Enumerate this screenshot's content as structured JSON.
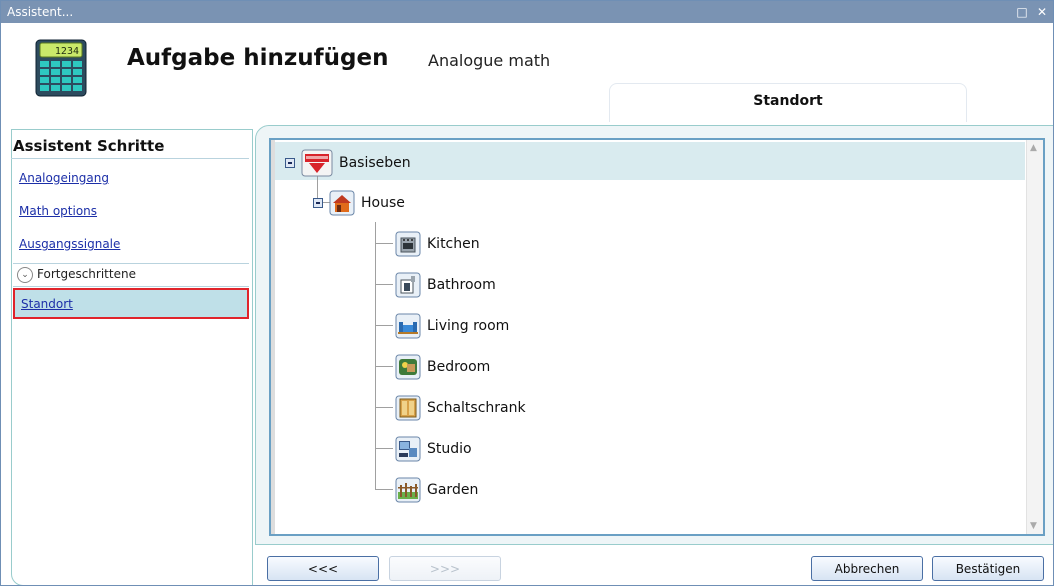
{
  "window": {
    "title": "Assistent...",
    "restore_glyph": "□",
    "close_glyph": "✕"
  },
  "header": {
    "title": "Aufgabe hinzufügen",
    "subtitle": "Analogue math",
    "icon": "calculator-icon",
    "calc_display": "1234"
  },
  "tab": {
    "label": "Standort"
  },
  "steps": {
    "title": "Assistent Schritte",
    "items": [
      {
        "label": "Analogeingang"
      },
      {
        "label": "Math options"
      },
      {
        "label": "Ausgangssignale"
      }
    ],
    "advanced_label": "Fortgeschrittene",
    "selected_label": "Standort"
  },
  "tree": {
    "root": {
      "label": "Basiseben",
      "icon": "carlo-gavazzi-logo-icon"
    },
    "house": {
      "label": "House",
      "icon": "house-icon"
    },
    "rooms": [
      {
        "label": "Kitchen",
        "icon": "kitchen-icon"
      },
      {
        "label": "Bathroom",
        "icon": "bathroom-icon"
      },
      {
        "label": "Living room",
        "icon": "sofa-icon"
      },
      {
        "label": "Bedroom",
        "icon": "bedroom-icon"
      },
      {
        "label": "Schaltschrank",
        "icon": "cabinet-icon"
      },
      {
        "label": "Studio",
        "icon": "studio-icon"
      },
      {
        "label": "Garden",
        "icon": "garden-icon"
      }
    ]
  },
  "buttons": {
    "back": "<<<",
    "next": ">>>",
    "cancel": "Abbrechen",
    "confirm": "Bestätigen"
  },
  "colors": {
    "titlebar": "#7a93b3",
    "selection": "#bfe0e8",
    "highlight_border": "#e0242b",
    "link": "#1c2fa8"
  }
}
